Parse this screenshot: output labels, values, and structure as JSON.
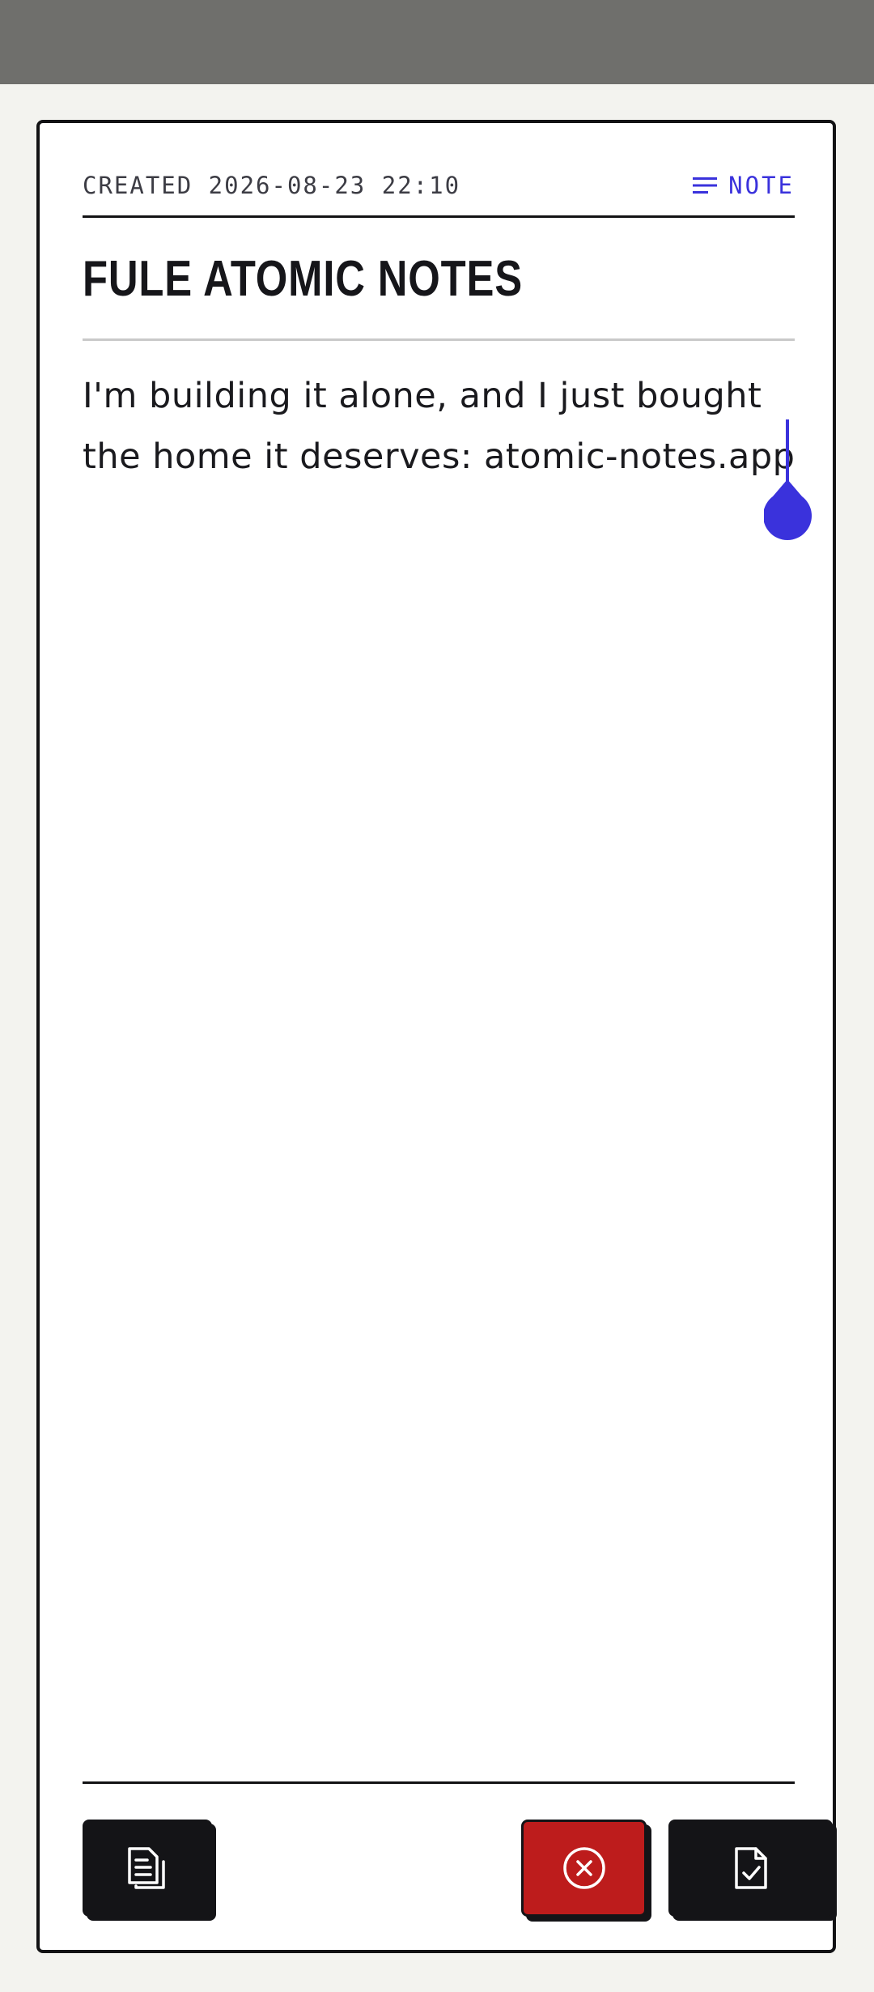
{
  "note": {
    "created_label": "CREATED 2026-08-23 22:10",
    "type_label": "NOTE",
    "title": "FULE ATOMIC NOTES",
    "body": "I'm building it alone, and I just bought the home it deserves: atomic-notes.app"
  },
  "icons": {
    "type_icon": "lines-icon",
    "copy_icon": "copy-documents-icon",
    "discard_icon": "close-circle-icon",
    "save_icon": "file-check-icon"
  },
  "colors": {
    "accent": "#3a32dc",
    "danger": "#bd1c1c",
    "ink": "#141417",
    "background": "#f3f3ef",
    "status_bar": "#6f6f6c"
  }
}
